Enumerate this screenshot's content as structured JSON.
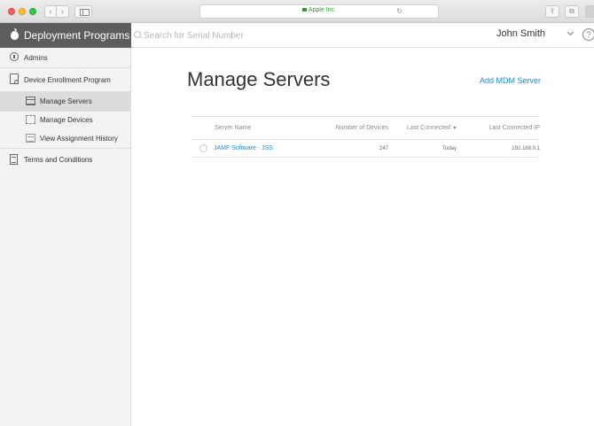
{
  "browser": {
    "url_text": "Apple Inc.",
    "back_glyph": "‹",
    "forward_glyph": "›",
    "share_glyph": "⇪",
    "tabs_glyph": "⧉",
    "reload_glyph": "↻"
  },
  "header": {
    "brand_title": "Deployment Programs",
    "search_placeholder": "Search for Serial Number",
    "user_name": "John Smith",
    "help_glyph": "?"
  },
  "sidebar": {
    "items": [
      {
        "label": "Admins"
      },
      {
        "label": "Device Enrollment Program"
      },
      {
        "label": "Manage Servers"
      },
      {
        "label": "Manage Devices"
      },
      {
        "label": "View Assignment History"
      },
      {
        "label": "Terms and Conditions"
      }
    ]
  },
  "main": {
    "title": "Manage Servers",
    "add_link": "Add MDM Server",
    "table": {
      "columns": [
        "Server Name",
        "Number of Devices",
        "Last Connected",
        "Last Connected IP"
      ],
      "rows": [
        {
          "name": "JAMF Software - JSS",
          "devices": "247",
          "last_connected": "Today",
          "ip": "192.168.0.1"
        }
      ]
    }
  },
  "colors": {
    "brand_bar": "#5d5d5d",
    "sidebar_bg": "#f3f3f3",
    "link": "#1a8bd8",
    "active_item": "#dcdcdc"
  }
}
